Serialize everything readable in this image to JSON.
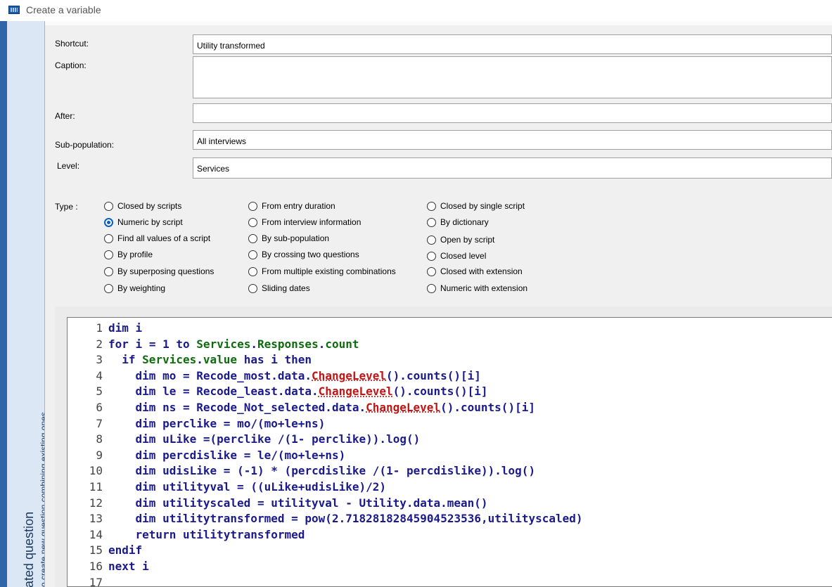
{
  "window": {
    "title": "Create a variable"
  },
  "side": {
    "heading": "ated question",
    "hint": "o create new question combining existing ones"
  },
  "form": {
    "shortcut_label": "Shortcut:",
    "shortcut_value": "Utility transformed",
    "caption_label": "Caption:",
    "caption_value": "",
    "after_label": "After:",
    "after_value": "",
    "subpop_label": "Sub-population:",
    "subpop_value": "All interviews",
    "level_label": "Level:",
    "level_value": "Services",
    "type_label": "Type :"
  },
  "types": [
    [
      "Closed by scripts",
      "Numeric by script",
      "Find all values of a script",
      "By profile",
      "By superposing questions",
      "By weighting"
    ],
    [
      "From entry duration",
      "From interview information",
      "By sub-population",
      "By crossing two questions",
      "From multiple existing combinations",
      "Sliding dates"
    ],
    [
      "Closed by single script",
      "By dictionary",
      "Open by script",
      "Closed level",
      "Closed with extension",
      "Numeric with extension"
    ]
  ],
  "selected_type": "Numeric by script",
  "code": {
    "line_numbers": [
      "1",
      "2",
      "3",
      "4",
      "5",
      "6",
      "7",
      "8",
      "9",
      "10",
      "11",
      "12",
      "13",
      "14",
      "15",
      "16",
      "17"
    ],
    "lines": [
      "dim i",
      "for i = 1 to Services.Responses.count",
      "  if Services.value has i then",
      "    dim mo = Recode_most.data.ChangeLevel().counts()[i]",
      "    dim le = Recode_least.data.ChangeLevel().counts()[i]",
      "    dim ns = Recode_Not_selected.data.ChangeLevel().counts()[i]",
      "    dim perclike = mo/(mo+le+ns)",
      "    dim uLike =(perclike /(1- perclike)).log()",
      "    dim percdislike = le/(mo+le+ns)",
      "    dim udisLike = (-1) * (percdislike /(1- percdislike)).log()",
      "    dim utilityval = ((uLike+udisLike)/2)",
      "    dim utilityscaled = utilityval - Utility.data.mean()",
      "    dim utilitytransformed = pow(2.71828182845904523536,utilityscaled)",
      "    return utilitytransformed",
      "endif",
      "next i",
      ""
    ]
  }
}
